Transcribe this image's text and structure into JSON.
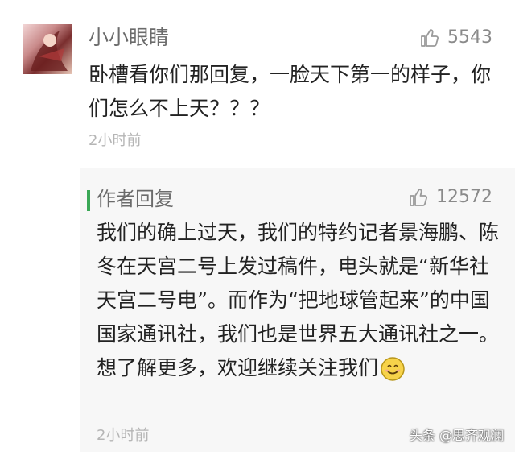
{
  "comment": {
    "username": "小小眼睛",
    "likes": "5543",
    "text": "卧槽看你们那回复，一脸天下第一的样子，你们怎么不上天？？？",
    "time": "2小时前"
  },
  "reply": {
    "title": "作者回复",
    "likes": "12572",
    "text": "我们的确上过天，我们的特约记者景海鹏、陈冬在天宫二号上发过稿件，电头就是“新华社天宫二号电”。而作为“把地球管起来”的中国国家通讯社，我们也是世界五大通讯社之一。想了解更多，欢迎继续关注我们",
    "emoji": "smile-emoji",
    "time": "2小时前",
    "accent_color": "#3aa856"
  },
  "watermark": "头条 @思齐观澜",
  "icons": {
    "like": "thumbs-up-icon"
  }
}
